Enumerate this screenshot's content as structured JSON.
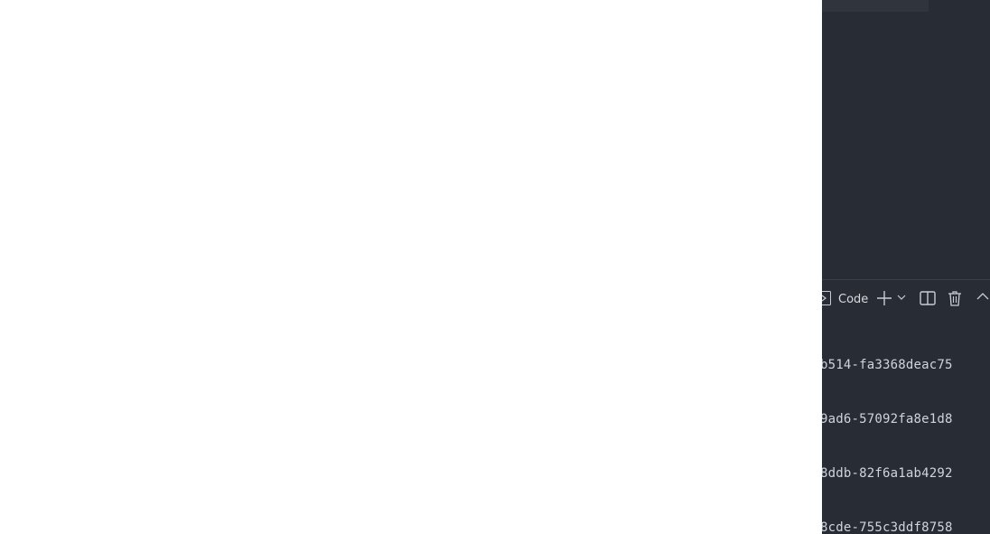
{
  "terminal": {
    "label": "Code",
    "icon": "terminal-icon",
    "toolbar_icons": [
      "add-icon",
      "chevron-down-icon",
      "split-icon",
      "trash-icon",
      "chevron-up-icon"
    ],
    "lines": [
      "b514-fa3368deac75",
      "9ad6-57092fa8e1d8",
      "8ddb-82f6a1ab4292",
      "8cde-755c3ddf8758"
    ]
  },
  "colors": {
    "panel_bg": "#282c34",
    "text": "#d0d4dc",
    "toolbar_icon": "#c8ccd4"
  }
}
